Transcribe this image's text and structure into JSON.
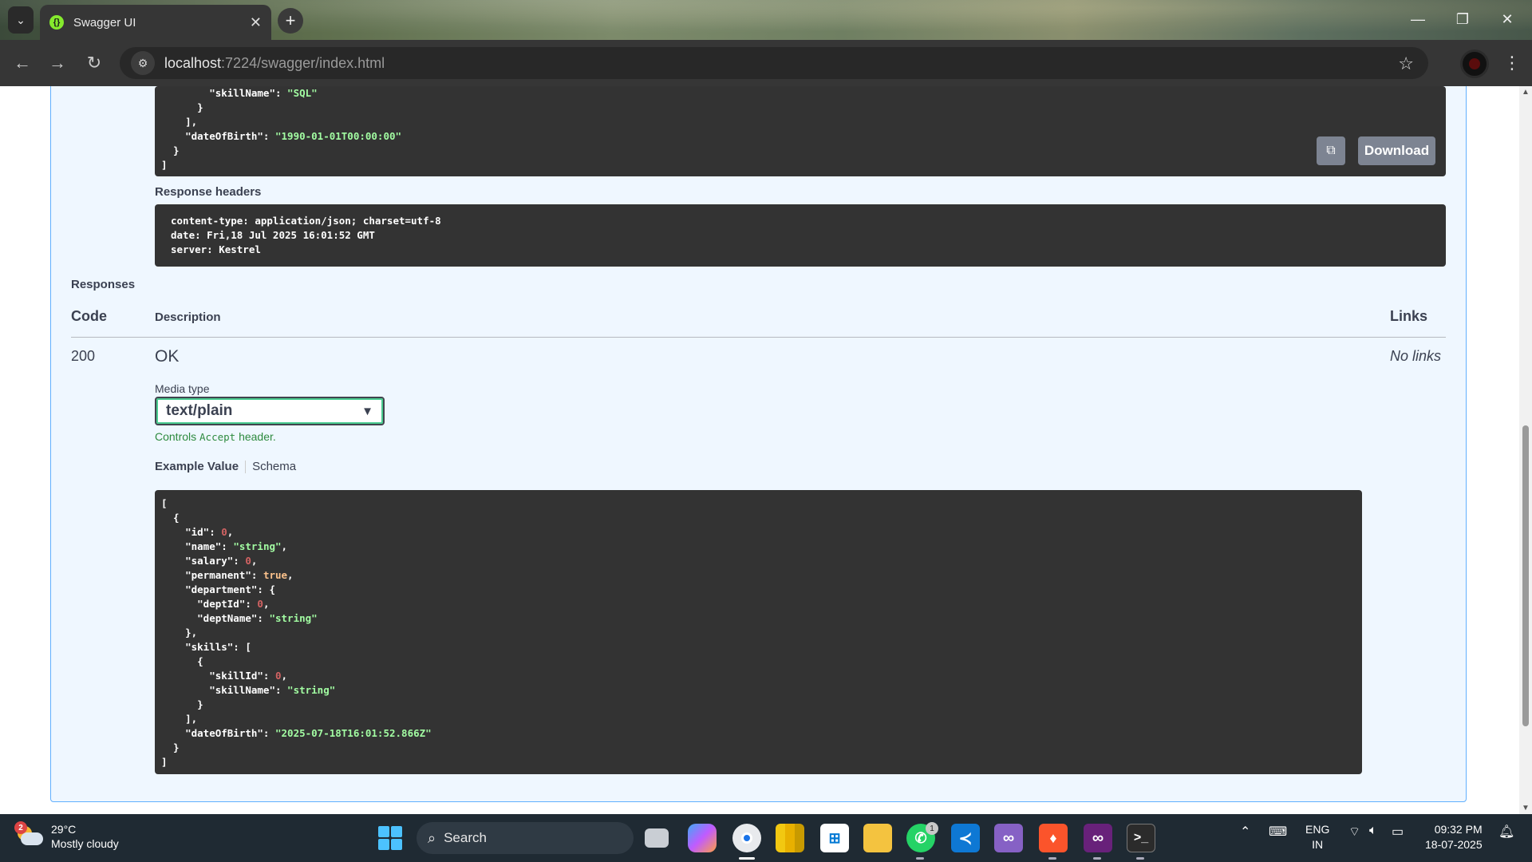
{
  "browser": {
    "tab_title": "Swagger UI",
    "url_host": "localhost",
    "url_rest": ":7224/swagger/index.html"
  },
  "response_body": {
    "lines": [
      [
        "        ",
        "\"skillName\"",
        ": ",
        "\"SQL\"",
        ""
      ],
      [
        "      }",
        "",
        "",
        "",
        ""
      ],
      [
        "    ],",
        "",
        "",
        "",
        ""
      ],
      [
        "    ",
        "\"dateOfBirth\"",
        ": ",
        "\"1990-01-01T00:00:00\"",
        ""
      ],
      [
        "  }",
        "",
        "",
        "",
        ""
      ],
      [
        "]",
        "",
        "",
        "",
        ""
      ]
    ],
    "download_label": "Download"
  },
  "response_headers": {
    "label": "Response headers",
    "lines": [
      "content-type: application/json; charset=utf-8",
      "date: Fri,18 Jul 2025 16:01:52 GMT",
      "server: Kestrel"
    ]
  },
  "responses": {
    "title": "Responses",
    "col_code": "Code",
    "col_description": "Description",
    "col_links": "Links",
    "row": {
      "code": "200",
      "description": "OK",
      "links": "No links",
      "media_type_label": "Media type",
      "media_type_value": "text/plain",
      "controls_prefix": "Controls",
      "controls_code": "Accept",
      "controls_suffix": "header.",
      "tab_example": "Example Value",
      "tab_schema": "Schema"
    }
  },
  "example_value": {
    "lines": [
      "[",
      "  {",
      "    \"id\": 0,",
      "    \"name\": \"string\",",
      "    \"salary\": 0,",
      "    \"permanent\": true,",
      "    \"department\": {",
      "      \"deptId\": 0,",
      "      \"deptName\": \"string\"",
      "    },",
      "    \"skills\": [",
      "      {",
      "        \"skillId\": 0,",
      "        \"skillName\": \"string\"",
      "      }",
      "    ],",
      "    \"dateOfBirth\": \"2025-07-18T16:01:52.866Z\"",
      "  }",
      "]"
    ]
  },
  "taskbar": {
    "weather_temp": "29°C",
    "weather_desc": "Mostly cloudy",
    "weather_badge": "2",
    "search_label": "Search",
    "whatsapp_badge": "1",
    "lang_top": "ENG",
    "lang_bottom": "IN",
    "time": "09:32 PM",
    "date": "18-07-2025"
  },
  "colors": {
    "swagger_blue": "#61affe",
    "code_bg": "#333333",
    "string_green": "#a2fca2",
    "number_red": "#d36363",
    "bool_orange": "#fcc28c"
  }
}
